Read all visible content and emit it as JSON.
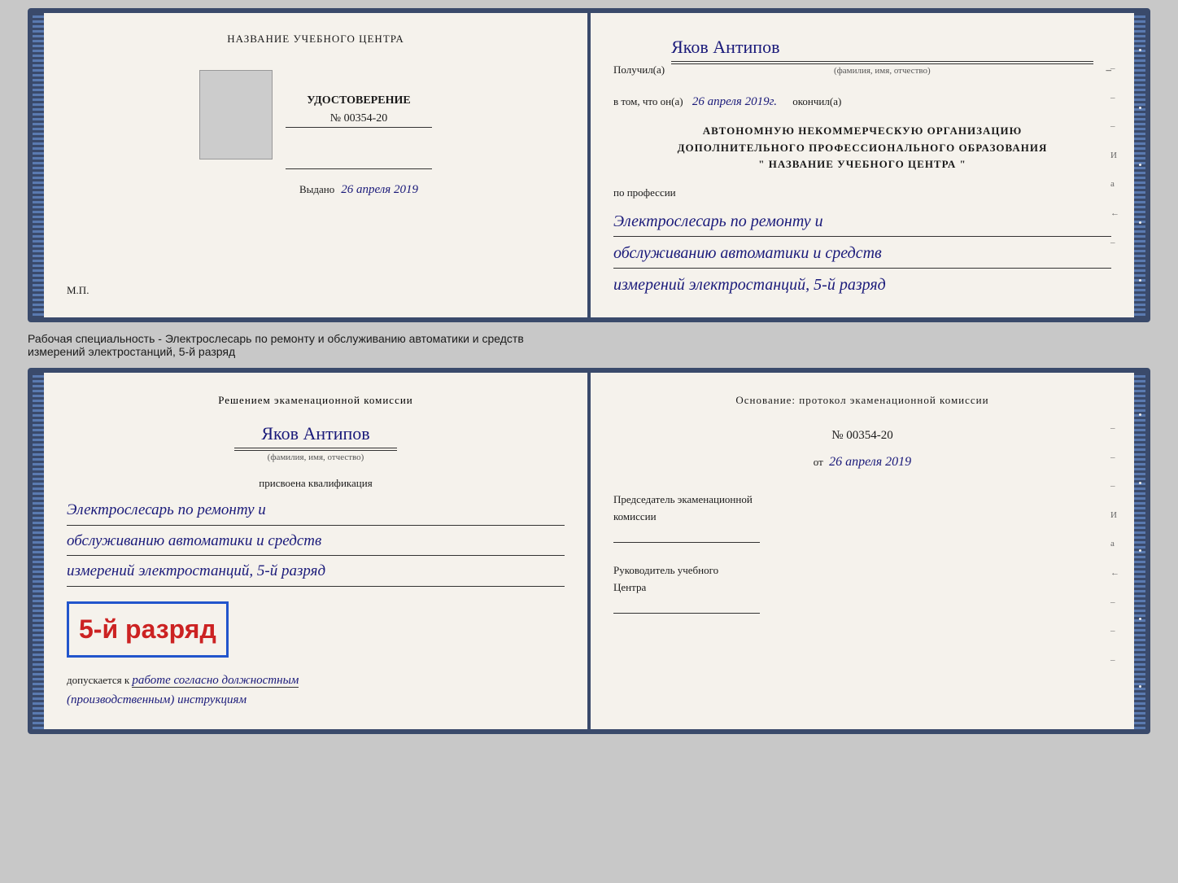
{
  "topBook": {
    "leftPage": {
      "centerTitle": "НАЗВАНИЕ УЧЕБНОГО ЦЕНТРА",
      "certLabel": "УДОСТОВЕРЕНИЕ",
      "certNumber": "№ 00354-20",
      "issuedLabel": "Выдано",
      "issuedDate": "26 апреля 2019",
      "mpLabel": "М.П."
    },
    "rightPage": {
      "receivedLabel": "Получил(а)",
      "recipientName": "Яков Антипов",
      "recipientSubLabel": "(фамилия, имя, отчество)",
      "inThatLabel": "в том, что он(а)",
      "completedDate": "26 апреля 2019г.",
      "completedLabel": "окончил(а)",
      "orgLine1": "АВТОНОМНУЮ НЕКОММЕРЧЕСКУЮ ОРГАНИЗАЦИЮ",
      "orgLine2": "ДОПОЛНИТЕЛЬНОГО ПРОФЕССИОНАЛЬНОГО ОБРАЗОВАНИЯ",
      "orgLine3": "\"   НАЗВАНИЕ УЧЕБНОГО ЦЕНТРА   \"",
      "professionLabel": "по профессии",
      "specialtyLine1": "Электрослесарь по ремонту и",
      "specialtyLine2": "обслуживанию автоматики и средств",
      "specialtyLine3": "измерений электростанций, 5-й разряд"
    }
  },
  "betweenLabel": "Рабочая специальность - Электрослесарь по ремонту и обслуживанию автоматики и средств\nизмерений электростанций, 5-й разряд",
  "bottomBook": {
    "leftPage": {
      "commissionLabel": "Решением экаменационной комиссии",
      "personName": "Яков Антипов",
      "personSubLabel": "(фамилия, имя, отчество)",
      "qualificationLabel": "присвоена квалификация",
      "qualLine1": "Электрослесарь по ремонту и",
      "qualLine2": "обслуживанию автоматики и средств",
      "qualLine3": "измерений электростанций, 5-й разряд",
      "gradeBadge": "5-й разряд",
      "allowedLabel": "допускается к",
      "allowedText": "работе согласно должностным",
      "allowedText2": "(производственным) инструкциям"
    },
    "rightPage": {
      "basisLabel": "Основание: протокол экаменационной комиссии",
      "protocolNumber": "№ 00354-20",
      "protocolDateLabel": "от",
      "protocolDate": "26 апреля 2019",
      "chairmanLabel": "Председатель экаменационной",
      "chairmanLabel2": "комиссии",
      "headLabel": "Руководитель учебного",
      "headLabel2": "Центра"
    }
  },
  "rightMarginTop": [
    "–",
    "–",
    "–",
    "И",
    "а",
    "←",
    "–"
  ],
  "rightMarginBottom": [
    "–",
    "–",
    "–",
    "И",
    "а",
    "←",
    "–",
    "–",
    "–"
  ]
}
